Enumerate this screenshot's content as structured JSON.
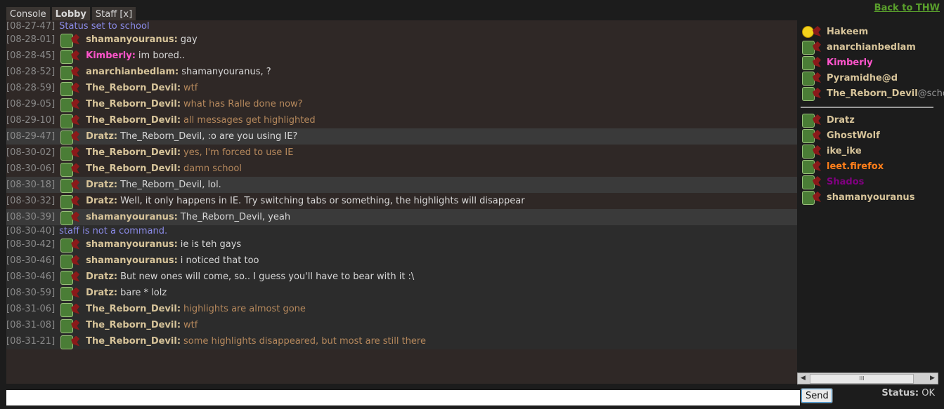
{
  "tabs": [
    {
      "label": "Console"
    },
    {
      "label": "Lobby"
    },
    {
      "label": "Staff [x]"
    }
  ],
  "back_link": "Back to THW",
  "messages": [
    {
      "ts": "[08-27-47]",
      "type": "system",
      "text": "Status set to school"
    },
    {
      "ts": "[08-28-01]",
      "nick": "shamanyouranus:",
      "text": "gay",
      "style": "normal"
    },
    {
      "ts": "[08-28-45]",
      "nick": "Kimberly:",
      "text": "im bored..",
      "style": "normal"
    },
    {
      "ts": "[08-28-52]",
      "nick": "anarchianbedlam:",
      "text": "shamanyouranus, ?",
      "style": "normal"
    },
    {
      "ts": "[08-28-59]",
      "nick": "The_Reborn_Devil:",
      "text": "wtf",
      "style": "orange"
    },
    {
      "ts": "[08-29-05]",
      "nick": "The_Reborn_Devil:",
      "text": "what has Ralle done now?",
      "style": "orange"
    },
    {
      "ts": "[08-29-10]",
      "nick": "The_Reborn_Devil:",
      "text": "all messages get highlighted",
      "style": "orange"
    },
    {
      "ts": "[08-29-47]",
      "nick": "Dratz:",
      "text": "The_Reborn_Devil, :o are you using IE?",
      "style": "normal"
    },
    {
      "ts": "[08-30-02]",
      "nick": "The_Reborn_Devil:",
      "text": "yes, I'm forced to use IE",
      "style": "orange"
    },
    {
      "ts": "[08-30-06]",
      "nick": "The_Reborn_Devil:",
      "text": "damn school",
      "style": "orange"
    },
    {
      "ts": "[08-30-18]",
      "nick": "Dratz:",
      "text": "The_Reborn_Devil, lol.",
      "style": "normal"
    },
    {
      "ts": "[08-30-32]",
      "nick": "Dratz:",
      "text": "Well, it only happens in IE. Try switching tabs or something, the highlights will disappear",
      "style": "normal"
    },
    {
      "ts": "[08-30-39]",
      "nick": "shamanyouranus:",
      "text": "The_Reborn_Devil, yeah",
      "style": "normal"
    },
    {
      "ts": "[08-30-40]",
      "type": "system",
      "text": "staff is not a command."
    },
    {
      "ts": "[08-30-42]",
      "nick": "shamanyouranus:",
      "text": "ie is teh gays",
      "style": "normal"
    },
    {
      "ts": "[08-30-46]",
      "nick": "shamanyouranus:",
      "text": "i noticed that too",
      "style": "normal"
    },
    {
      "ts": "[08-30-46]",
      "nick": "Dratz:",
      "text": "But new ones will come, so.. I guess you'll have to bear with it :\\",
      "style": "normal"
    },
    {
      "ts": "[08-30-59]",
      "nick": "Dratz:",
      "text": "bare * lolz",
      "style": "normal"
    },
    {
      "ts": "[08-31-06]",
      "nick": "The_Reborn_Devil:",
      "text": "highlights are almost gone",
      "style": "orange"
    },
    {
      "ts": "[08-31-08]",
      "nick": "The_Reborn_Devil:",
      "text": "wtf",
      "style": "orange"
    },
    {
      "ts": "[08-31-21]",
      "nick": "The_Reborn_Devil:",
      "text": "some highlights disappeared, but most are still there",
      "style": "orange"
    }
  ],
  "users_top": [
    {
      "name": "Hakeem",
      "icon": "smiley-icon"
    },
    {
      "name": "anarchianbedlam",
      "icon": "avatar-icon"
    },
    {
      "name": "Kimberly",
      "icon": "avatar-icon",
      "color": "kim"
    },
    {
      "name": "Pyramidhe@d",
      "icon": "avatar-icon"
    },
    {
      "name": "The_Reborn_Devil",
      "status": "@school",
      "icon": "avatar-icon"
    }
  ],
  "users_bottom": [
    {
      "name": "Dratz"
    },
    {
      "name": "GhostWolf"
    },
    {
      "name": "ike_ike"
    },
    {
      "name": "leet.firefox",
      "color": "firefox"
    },
    {
      "name": "Shados",
      "color": "shados"
    },
    {
      "name": "shamanyouranus"
    }
  ],
  "scrollbar": {
    "thumb": "III"
  },
  "input": {
    "value": ""
  },
  "send_label": "Send",
  "status": {
    "label": "Status:",
    "value": "OK"
  }
}
